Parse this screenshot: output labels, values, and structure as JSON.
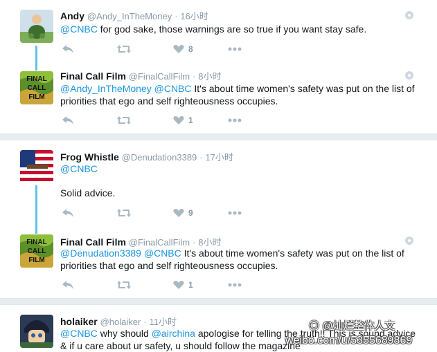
{
  "conversations": [
    {
      "tweets": [
        {
          "name": "Andy",
          "handle": "@Andy_InTheMoney",
          "dot": "·",
          "time": "16小时",
          "text": [
            {
              "t": "@CNBC",
              "m": true
            },
            {
              "t": " for god sake, those warnings are so true if you want stay safe.",
              "m": false
            }
          ],
          "avatar": "andy-avatar",
          "likes": "8"
        },
        {
          "name": "Final Call Film",
          "handle": "@FinalCallFilm",
          "dot": "·",
          "time": "8小时",
          "text": [
            {
              "t": "@Andy_InTheMoney",
              "m": true
            },
            {
              "t": " ",
              "m": false
            },
            {
              "t": "@CNBC",
              "m": true
            },
            {
              "t": " It's about time women's safety was put on the list of priorities that ego and self righteousness occupies.",
              "m": false
            }
          ],
          "avatar_label": "FINAL CALL FILM",
          "likes": "1"
        }
      ]
    },
    {
      "tweets": [
        {
          "name": "Frog Whistle",
          "handle": "@Denudation3389",
          "dot": "·",
          "time": "17小时",
          "text": [
            {
              "t": "@CNBC",
              "m": true
            }
          ],
          "text2": "Solid advice.",
          "avatar": "flag-avatar",
          "likes": "9"
        },
        {
          "name": "Final Call Film",
          "handle": "@FinalCallFilm",
          "dot": "·",
          "time": "8小时",
          "text": [
            {
              "t": "@Denudation3389",
              "m": true
            },
            {
              "t": " ",
              "m": false
            },
            {
              "t": "@CNBC",
              "m": true
            },
            {
              "t": " It's about time women's safety was put on the list of priorities that ego and self righteousness occupies.",
              "m": false
            }
          ],
          "avatar_label": "FINAL CALL FILM",
          "likes": "1"
        }
      ]
    },
    {
      "tweets": [
        {
          "name": "holaiker",
          "handle": "@holaiker",
          "dot": "·",
          "time": "11小时",
          "text": [
            {
              "t": "@CNBC",
              "m": true
            },
            {
              "t": " why should ",
              "m": false
            },
            {
              "t": "@airchina",
              "m": true
            },
            {
              "t": " apologise for telling the truth!! This is sound advice & if u care about ur safety, u should follow the magazine",
              "m": false
            }
          ],
          "avatar": "anime-avatar"
        }
      ]
    }
  ],
  "watermark": {
    "line1": "@灿烂整体人文",
    "line2": "weibo.com/u/5355689869"
  },
  "colors": {
    "mention": "#1b95e0",
    "thread_line": "#5fc3e4",
    "separator": "#e6ecf0",
    "muted": "#8899a6"
  }
}
